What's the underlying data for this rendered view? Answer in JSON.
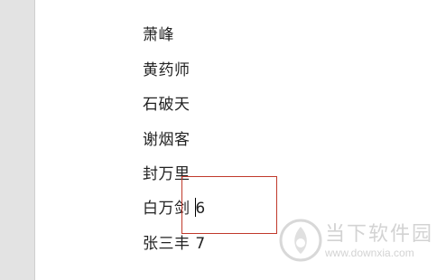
{
  "document": {
    "lines": [
      "萧峰",
      "黄药师",
      "石破天",
      "谢烟客",
      "封万里",
      "白万剑 6",
      "张三丰 7"
    ]
  },
  "watermark": {
    "title": "当下软件园",
    "url": "www.downxia.com"
  },
  "colors": {
    "selection_box": "#c0392b",
    "text": "#222222",
    "watermark": "#d3d3d3"
  }
}
